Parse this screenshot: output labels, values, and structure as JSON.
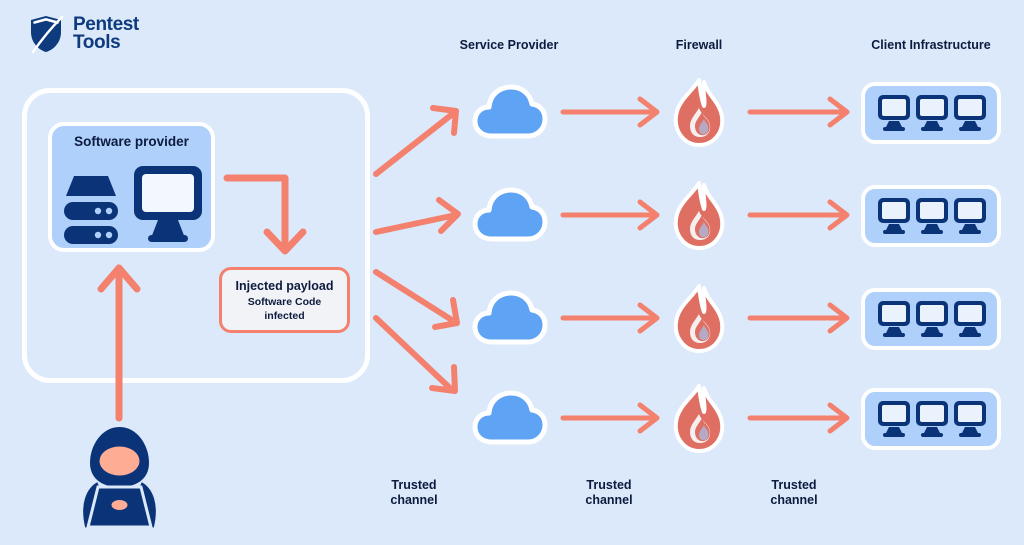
{
  "brand": {
    "name_line1": "Pentest",
    "name_line2": "Tools",
    "logo_icon": "shield-icon",
    "navy": "#0e3a7e"
  },
  "colors": {
    "background": "#dbe9fb",
    "panel_border": "#ffffff",
    "card_fill": "#aed0fa",
    "navy": "#0b3378",
    "arrow": "#f4806e",
    "cloud": "#5fa3f5",
    "flame": "#df6f62",
    "skin": "#ffac95"
  },
  "column_headings": [
    {
      "label": "Service Provider"
    },
    {
      "label": "Firewall"
    },
    {
      "label": "Client Infrastructure"
    }
  ],
  "attacker": {
    "icon": "hacker-icon"
  },
  "software_provider": {
    "title": "Software provider",
    "icons": [
      "server-stack-icon",
      "desktop-monitor-icon"
    ]
  },
  "injected_payload": {
    "title": "Injected payload",
    "subtitle_line1": "Software Code",
    "subtitle_line2": "infected"
  },
  "rows": [
    {
      "cloud": "cloud-icon",
      "firewall": "flame-icon",
      "clients": [
        "monitor-icon",
        "monitor-icon",
        "monitor-icon"
      ]
    },
    {
      "cloud": "cloud-icon",
      "firewall": "flame-icon",
      "clients": [
        "monitor-icon",
        "monitor-icon",
        "monitor-icon"
      ]
    },
    {
      "cloud": "cloud-icon",
      "firewall": "flame-icon",
      "clients": [
        "monitor-icon",
        "monitor-icon",
        "monitor-icon"
      ]
    },
    {
      "cloud": "cloud-icon",
      "firewall": "flame-icon",
      "clients": [
        "monitor-icon",
        "monitor-icon",
        "monitor-icon"
      ]
    }
  ],
  "trusted_channels": [
    {
      "line1": "Trusted",
      "line2": "channel"
    },
    {
      "line1": "Trusted",
      "line2": "channel"
    },
    {
      "line1": "Trusted",
      "line2": "channel"
    }
  ],
  "flows": {
    "attacker_to_provider": "upward-arrow",
    "provider_to_payload": "elbow-arrow",
    "payload_to_clouds": [
      "fanout-arrow",
      "fanout-arrow",
      "fanout-arrow",
      "fanout-arrow"
    ],
    "cloud_to_firewall": [
      "straight-arrow",
      "straight-arrow",
      "straight-arrow",
      "straight-arrow"
    ],
    "firewall_to_client": [
      "straight-arrow",
      "straight-arrow",
      "straight-arrow",
      "straight-arrow"
    ]
  }
}
